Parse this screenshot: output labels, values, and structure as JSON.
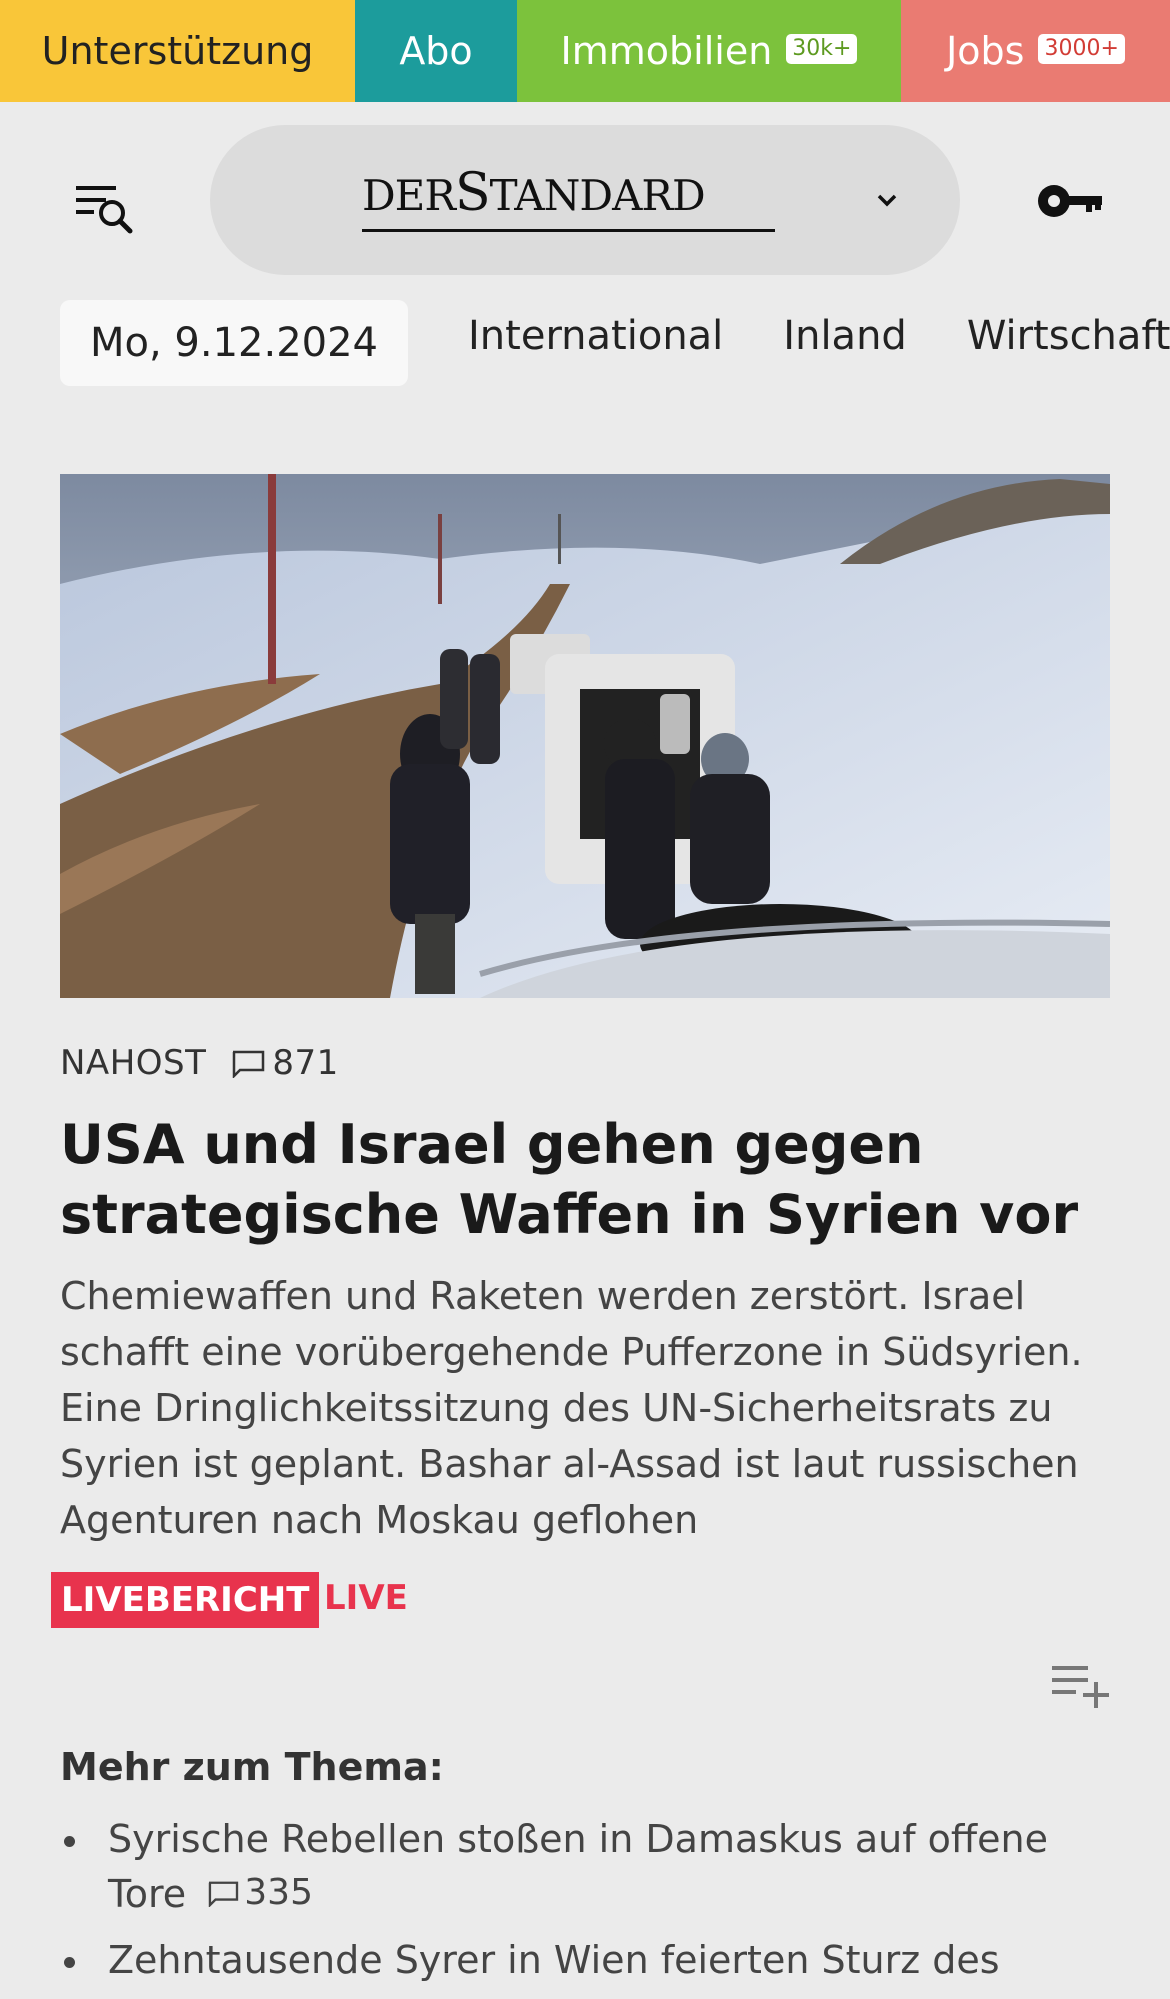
{
  "topbar": {
    "support": "Unterstützung",
    "abo": "Abo",
    "immobilien": "Immobilien",
    "immobilien_badge": "30k+",
    "jobs": "Jobs",
    "jobs_badge": "3000+"
  },
  "header": {
    "logo_der": "DER",
    "logo_s": "S",
    "logo_tandard": "TANDARD",
    "menu_icon": "menu-search-icon",
    "dropdown_icon": "chevron-down-icon",
    "login_icon": "key-icon"
  },
  "date": "Mo, 9.12.2024",
  "nav": {
    "items": [
      "International",
      "Inland",
      "Wirtschaft"
    ]
  },
  "article": {
    "kicker": "NAHOST",
    "comments": "871",
    "headline": "USA und Israel gehen gegen strategische Waffen in Syrien vor",
    "lead": "Chemiewaffen und Raketen werden zerstört. Israel schafft eine vorübergehende Pufferzone in Südsyrien. Eine Dringlichkeitssitzung des UN-Sicherheitsrats zu Syrien ist geplant. Bashar al-Assad ist laut russischen Agenturen nach Moskau geflohen",
    "live_tag": "LIVEBERICHT",
    "live_word": "LIVE"
  },
  "more": {
    "title": "Mehr zum Thema:",
    "items": [
      {
        "text": "Syrische Rebellen stoßen in Damaskus auf offene Tore",
        "comments": "335"
      },
      {
        "text": "Zehntausende Syrer in Wien feierten Sturz des",
        "comments": ""
      }
    ]
  },
  "colors": {
    "support": "#f9c639",
    "abo": "#1c9c9c",
    "immobilien": "#7cc23c",
    "jobs": "#ea7b72",
    "live": "#e8334d",
    "background": "#ebebeb"
  }
}
